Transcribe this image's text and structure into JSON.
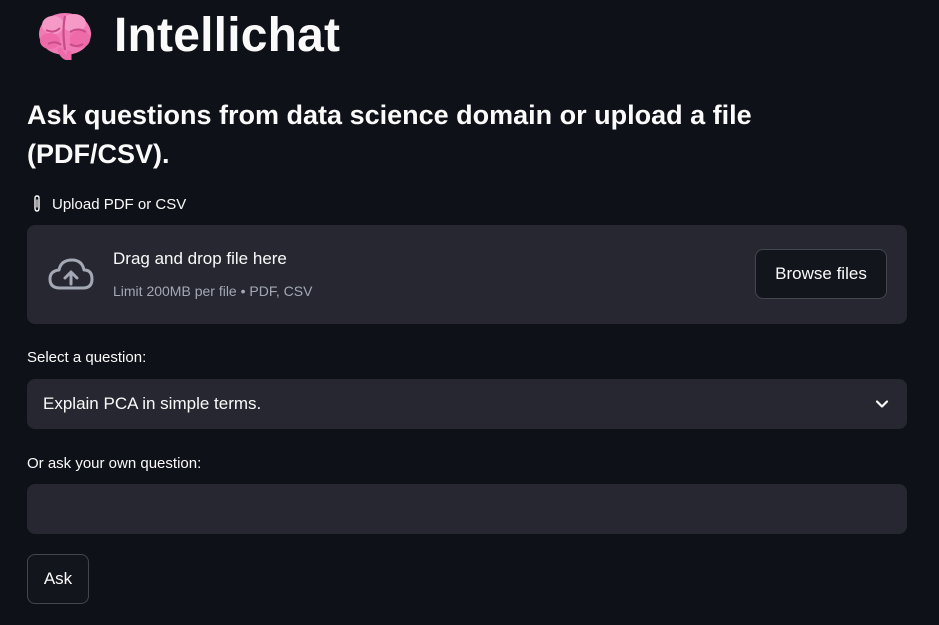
{
  "app": {
    "title": "Intellichat",
    "icon": "brain-icon"
  },
  "subheader": "Ask questions from data science domain or upload a file (PDF/CSV).",
  "uploader": {
    "label": "Upload PDF or CSV",
    "label_icon": "paperclip-icon",
    "drop_text": "Drag and drop file here",
    "limit_text": "Limit 200MB per file • PDF, CSV",
    "drop_icon": "cloud-upload-icon",
    "browse_label": "Browse files"
  },
  "question_select": {
    "label": "Select a question:",
    "selected": "Explain PCA in simple terms.",
    "icon": "chevron-down-icon"
  },
  "custom_question": {
    "label": "Or ask your own question:",
    "value": "",
    "placeholder": ""
  },
  "ask_button": {
    "label": "Ask"
  },
  "colors": {
    "background": "#0e1117",
    "widget": "#262730",
    "text": "#fafafa",
    "muted": "#a3a8b4",
    "border": "#43464f"
  }
}
